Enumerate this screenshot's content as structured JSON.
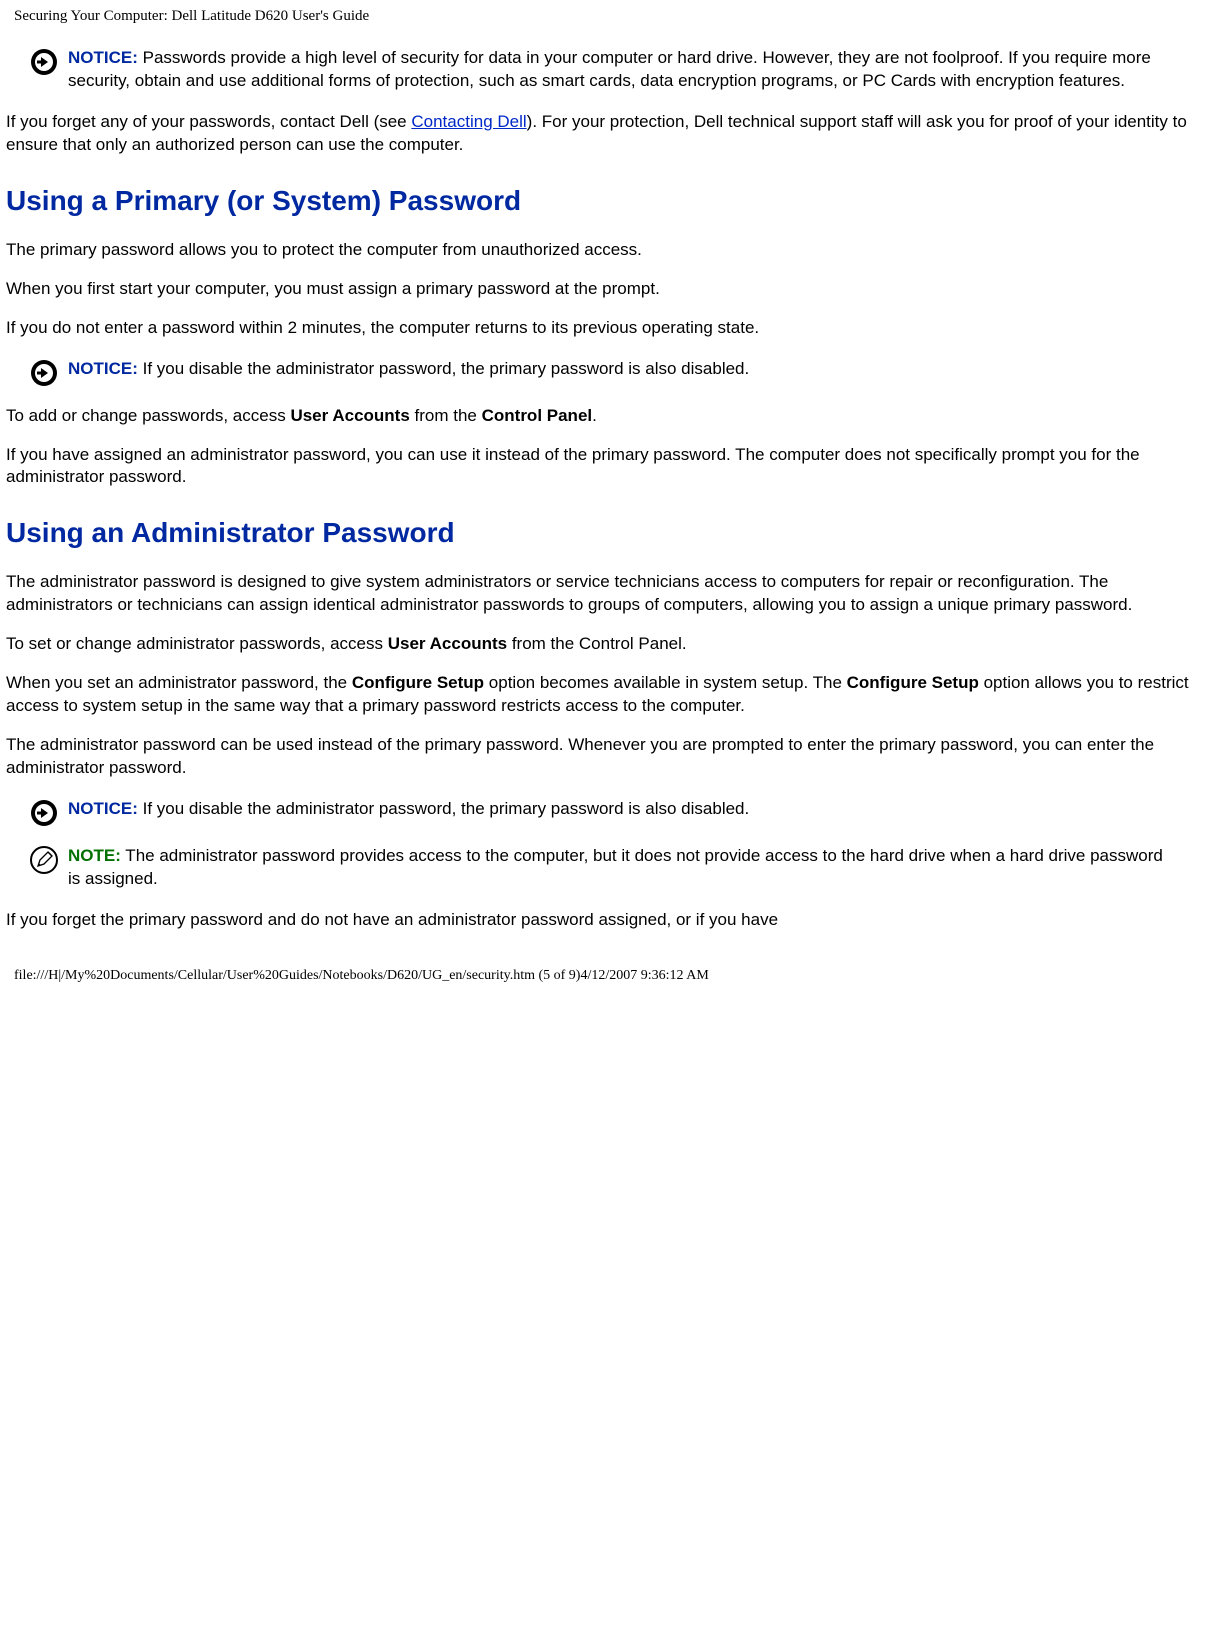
{
  "header": "Securing Your Computer: Dell Latitude D620 User's Guide",
  "labels": {
    "notice": "NOTICE:",
    "note": "NOTE:"
  },
  "notice1": " Passwords provide a high level of security for data in your computer or hard drive. However, they are not foolproof. If you require more security, obtain and use additional forms of protection, such as smart cards, data encryption programs, or PC Cards with encryption features.",
  "para1_pre": "If you forget any of your passwords, contact Dell (see ",
  "para1_link": "Contacting Dell",
  "para1_post": "). For your protection, Dell technical support staff will ask you for proof of your identity to ensure that only an authorized person can use the computer.",
  "h_primary": "Using a Primary (or System) Password",
  "para2": "The primary password allows you to protect the computer from unauthorized access.",
  "para3": "When you first start your computer, you must assign a primary password at the prompt.",
  "para4": "If you do not enter a password within 2 minutes, the computer returns to its previous operating state.",
  "notice2": " If you disable the administrator password, the primary password is also disabled.",
  "para5_pre": "To add or change passwords, access ",
  "para5_b1": "User Accounts",
  "para5_mid": " from the ",
  "para5_b2": "Control Panel",
  "para5_post": ".",
  "para6": "If you have assigned an administrator password, you can use it instead of the primary password. The computer does not specifically prompt you for the administrator password.",
  "h_admin": "Using an Administrator Password",
  "para7": "The administrator password is designed to give system administrators or service technicians access to computers for repair or reconfiguration. The administrators or technicians can assign identical administrator passwords to groups of computers, allowing you to assign a unique primary password.",
  "para8_pre": "To set or change administrator passwords, access ",
  "para8_b1": "User Accounts",
  "para8_post": " from the Control Panel.",
  "para9_pre": "When you set an administrator password, the ",
  "para9_b1": "Configure Setup",
  "para9_mid": " option becomes available in system setup. The ",
  "para9_b2": "Configure Setup",
  "para9_post": " option allows you to restrict access to system setup in the same way that a primary password restricts access to the computer.",
  "para10": "The administrator password can be used instead of the primary password. Whenever you are prompted to enter the primary password, you can enter the administrator password.",
  "notice3": " If you disable the administrator password, the primary password is also disabled.",
  "note1": " The administrator password provides access to the computer, but it does not provide access to the hard drive when a hard drive password is assigned.",
  "para11": "If you forget the primary password and do not have an administrator password assigned, or if you have",
  "footer": "file:///H|/My%20Documents/Cellular/User%20Guides/Notebooks/D620/UG_en/security.htm (5 of 9)4/12/2007 9:36:12 AM"
}
